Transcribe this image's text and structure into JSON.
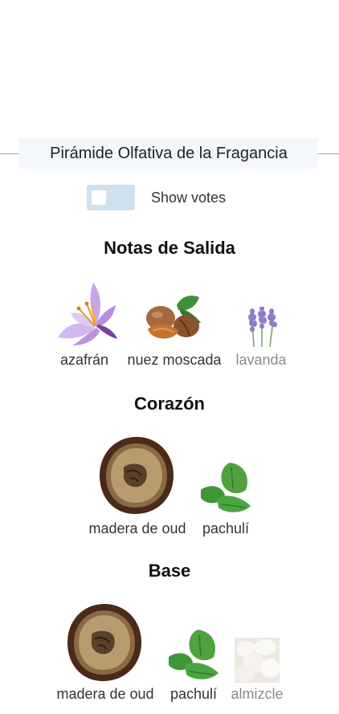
{
  "title": "Pirámide Olfativa de la Fragancia",
  "toggle": {
    "label": "Show votes",
    "checked": false
  },
  "sections": [
    {
      "title": "Notas de Salida",
      "notes": [
        {
          "name": "azafrán",
          "icon": "saffron-flower"
        },
        {
          "name": "nuez moscada",
          "icon": "nutmeg"
        },
        {
          "name": "lavanda",
          "icon": "lavender"
        }
      ]
    },
    {
      "title": "Corazón",
      "notes": [
        {
          "name": "madera de oud",
          "icon": "oud-wood"
        },
        {
          "name": "pachulí",
          "icon": "patchouli-leaf"
        }
      ]
    },
    {
      "title": "Base",
      "notes": [
        {
          "name": "madera de oud",
          "icon": "oud-wood"
        },
        {
          "name": "pachulí",
          "icon": "patchouli-leaf"
        },
        {
          "name": "almizcle",
          "icon": "musk"
        }
      ]
    }
  ],
  "colors": {
    "title_bg": "#f3f7fb",
    "toggle_bg": "#cfe0ef",
    "divider": "#8fb39a"
  }
}
